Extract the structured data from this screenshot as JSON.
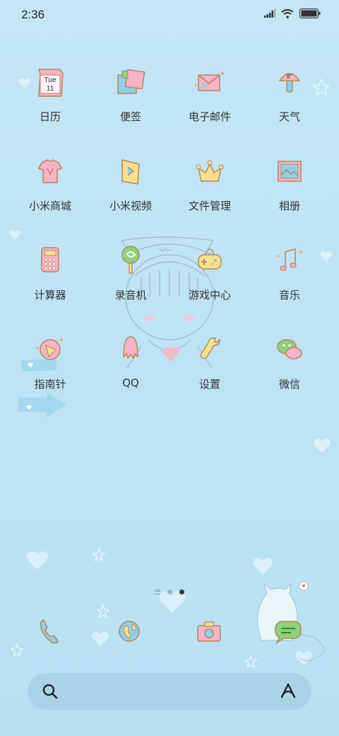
{
  "status_bar": {
    "time": "2:36",
    "icons": [
      "signal-icon",
      "wifi-icon",
      "battery-icon"
    ]
  },
  "apps": [
    {
      "label": "日历",
      "icon": "calendar-icon",
      "day": "Tue",
      "date": "11"
    },
    {
      "label": "便签",
      "icon": "notes-icon"
    },
    {
      "label": "电子邮件",
      "icon": "email-icon"
    },
    {
      "label": "天气",
      "icon": "weather-icon",
      "temp": "8°"
    },
    {
      "label": "小米商城",
      "icon": "mi-store-icon"
    },
    {
      "label": "小米视频",
      "icon": "mi-video-icon"
    },
    {
      "label": "文件管理",
      "icon": "file-manager-icon"
    },
    {
      "label": "相册",
      "icon": "gallery-icon"
    },
    {
      "label": "计算器",
      "icon": "calculator-icon"
    },
    {
      "label": "录音机",
      "icon": "recorder-icon"
    },
    {
      "label": "游戏中心",
      "icon": "game-center-icon"
    },
    {
      "label": "音乐",
      "icon": "music-icon"
    },
    {
      "label": "指南针",
      "icon": "compass-icon"
    },
    {
      "label": "QQ",
      "icon": "qq-icon"
    },
    {
      "label": "设置",
      "icon": "settings-icon"
    },
    {
      "label": "微信",
      "icon": "wechat-icon"
    }
  ],
  "pager": {
    "pages": 2,
    "active": 2
  },
  "dock": [
    "phone-icon",
    "browser-icon",
    "camera-icon",
    "messages-icon"
  ],
  "colors": {
    "background": "#c4e6f6",
    "accent_pink": "#f7b3c8",
    "accent_yellow": "#f8e08e",
    "accent_blue": "#8fd0ea",
    "accent_green": "#8ed27a",
    "outline": "#b6875a"
  }
}
